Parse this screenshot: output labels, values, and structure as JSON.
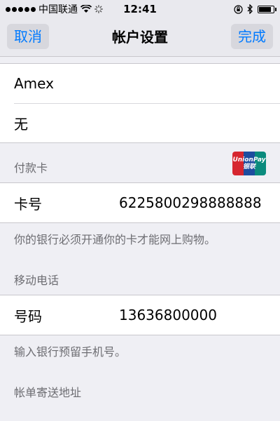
{
  "status_bar": {
    "carrier": "中国联通",
    "time": "12:41",
    "battery_level": 0.85
  },
  "nav": {
    "cancel_label": "取消",
    "title": "帐户设置",
    "done_label": "完成"
  },
  "top_group": {
    "items": [
      "Amex",
      "无"
    ]
  },
  "payment_section": {
    "header": "付款卡",
    "logo_text_en": "UnionPay",
    "logo_text_cn": "银联",
    "card_label": "卡号",
    "card_value": "6225800298888888",
    "footer": "你的银行必须开通你的卡才能网上购物。"
  },
  "phone_section": {
    "header": "移动电话",
    "phone_label": "号码",
    "phone_value": "13636800000",
    "footer": "输入银行预留手机号。"
  },
  "billing_section": {
    "header": "帐单寄送地址"
  }
}
